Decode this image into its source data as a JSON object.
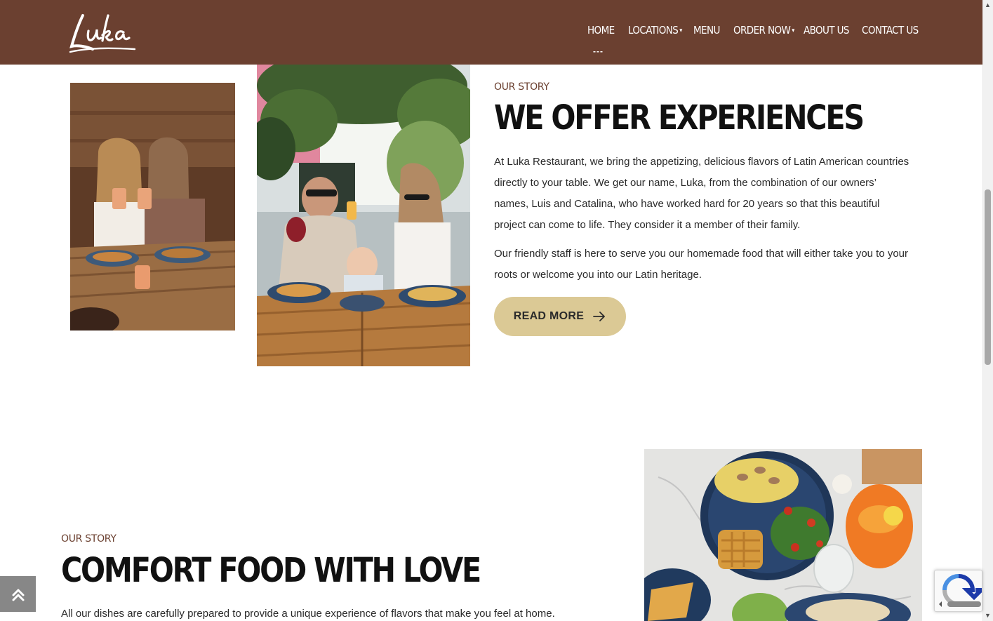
{
  "header": {
    "logo_text": "Luka",
    "nav": [
      {
        "label": "HOME",
        "active": true
      },
      {
        "label": "LOCATIONS",
        "dropdown": true
      },
      {
        "label": "MENU"
      },
      {
        "label": "ORDER NOW",
        "dropdown": true
      },
      {
        "label": "ABOUT US"
      },
      {
        "label": "CONTACT US"
      }
    ],
    "colors": {
      "background": "#6b4030",
      "text": "#ffffff"
    }
  },
  "story_section": {
    "eyebrow": "OUR STORY",
    "title": "WE OFFER EXPERIENCES",
    "paragraphs": [
      "At Luka Restaurant, we bring the appetizing, delicious flavors of Latin American countries directly to your table. We get our name, Luka, from the combination of our owners’ names, Luis and Catalina, who have worked hard for 20 years so that this beautiful project can come to life. They consider it a member of their family.",
      "Our friendly staff is here to serve you our homemade food that will either take you to your roots or welcome you into our Latin heritage."
    ],
    "button_label": "READ MORE",
    "button_color": "#dbc995"
  },
  "comfort_section": {
    "eyebrow": "OUR STORY",
    "title": "COMFORT FOOD WITH LOVE",
    "paragraph": "All our dishes are carefully prepared to provide a unique experience of flavors that make you feel at home."
  },
  "icons": {
    "back_to_top": "double-chevron-up-icon",
    "arrow": "arrow-right-icon",
    "caret": "caret-down-icon"
  }
}
